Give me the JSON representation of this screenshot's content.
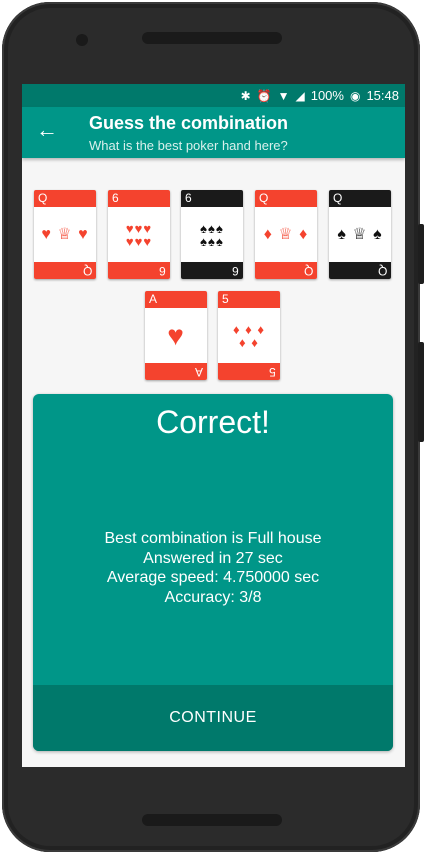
{
  "status_bar": {
    "battery": "100%",
    "time": "15:48"
  },
  "app_bar": {
    "title": "Guess the combination",
    "subtitle": "What is the best poker hand here?"
  },
  "cards": [
    {
      "rank": "Q",
      "suit": "hearts",
      "color": "red",
      "pips": "♥ ♕ ♥"
    },
    {
      "rank": "6",
      "suit": "hearts",
      "color": "red",
      "pips": "♥♥♥ ♥♥♥"
    },
    {
      "rank": "6",
      "suit": "spades",
      "color": "black",
      "pips": "♠♠♠ ♠♠♠"
    },
    {
      "rank": "Q",
      "suit": "diamonds",
      "color": "red",
      "pips": "♦ ♕ ♦"
    },
    {
      "rank": "Q",
      "suit": "spades",
      "color": "black",
      "pips": "♠ ♕ ♠"
    },
    {
      "rank": "A",
      "suit": "hearts",
      "color": "red",
      "pips": "♥"
    },
    {
      "rank": "5",
      "suit": "diamonds",
      "color": "red",
      "pips": "♦ ♦ ♦ ♦ ♦"
    }
  ],
  "result": {
    "headline": "Correct!",
    "combination": "Best combination is Full house",
    "answered": "Answered in 27 sec",
    "average": "Average speed: 4.750000 sec",
    "accuracy": "Accuracy: 3/8",
    "continue_label": "CONTINUE"
  },
  "colors": {
    "primary": "#009688",
    "primary_dark": "#00796b",
    "card_red": "#f4432e",
    "card_black": "#1a1a1a"
  }
}
